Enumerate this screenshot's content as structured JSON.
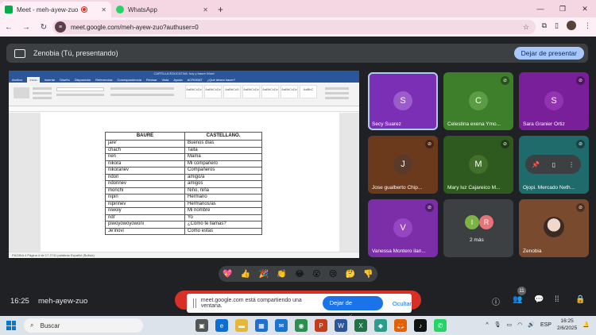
{
  "tabs": [
    {
      "title": "Meet - meh-ayew-zuo",
      "active": true
    },
    {
      "title": "WhatsApp",
      "active": false
    }
  ],
  "address": {
    "url": "meet.google.com/meh-ayew-zuo?authuser=0"
  },
  "presenting": {
    "label": "Zenobia (Tú, presentando)",
    "stop_label": "Dejar de presentar"
  },
  "word": {
    "title": "CARTILLA EDUCATIVA: hoy y baure  Word",
    "tabs": [
      "Archivo",
      "Inicio",
      "Insertar",
      "Diseño",
      "Disposición",
      "Referencias",
      "Correspondencia",
      "Revisar",
      "Vista",
      "Ayuda",
      "ACROBAT",
      "¿Qué desea hacer?"
    ],
    "styles": [
      "AaBbCcDc",
      "AaBbCcDc",
      "AaBbCcD",
      "AaBbCcDc",
      "AaBbCcDc",
      "AaBbCcDc",
      "AaBbC"
    ],
    "status": "PÁGINA 4    Página 4 de 17    2741 palabras    Español (Bolivia)"
  },
  "table": {
    "headers": [
      "BAURE",
      "CASTELLANO."
    ],
    "rows": [
      [
        "jare'",
        "Buenos días"
      ],
      [
        "chach",
        "Taita"
      ],
      [
        "nen",
        "Mama"
      ],
      [
        "nikora",
        "Mi compañero"
      ],
      [
        "nikoranev",
        "Compañeros"
      ],
      [
        "ndori",
        "amigo/a"
      ],
      [
        "ndorinev",
        "amigos"
      ],
      [
        "monchi",
        "Niño, niña"
      ],
      [
        "nipiri",
        "Hermano"
      ],
      [
        "nipirinev",
        "Hermanos/as"
      ],
      [
        "niwoiy",
        "Mi nombre"
      ],
      [
        "ndi'",
        "Yo"
      ],
      [
        "piwoyowoyowoni",
        "¿Cómo te llamas?"
      ],
      [
        "Je'inovi",
        "Como estas"
      ]
    ]
  },
  "participants": [
    {
      "name": "Secy Suarez",
      "initial": "S",
      "bg": "#7b2fb5",
      "av": "#9b5ccb",
      "muted": false
    },
    {
      "name": "Celestina exena Ymo...",
      "initial": "C",
      "bg": "#3e7f2c",
      "av": "#5b9c44",
      "muted": true
    },
    {
      "name": "Sara Granier Ortiz",
      "initial": "S",
      "bg": "#7a1f9a",
      "av": "#9233b3",
      "muted": true
    },
    {
      "name": "Jose gualberto Chip...",
      "initial": "J",
      "bg": "#6b3a1c",
      "av": "#5a3a2a",
      "muted": true
    },
    {
      "name": "Mary luz Cajareico M...",
      "initial": "M",
      "bg": "#2f5a1f",
      "av": "#40702a",
      "muted": true
    },
    {
      "name": "Ojopi. Mercado Neth...",
      "initial": "",
      "bg": "#1f6a6a",
      "av": "#2c8080",
      "muted": true
    },
    {
      "name": "Vanessa Montero ilan...",
      "initial": "V",
      "bg": "#7b2ea8",
      "av": "#9646c2",
      "muted": true
    },
    {
      "name": "2 más",
      "initial": "",
      "bg": "#3c4043",
      "av": "#3c4043",
      "muted": false
    },
    {
      "name": "Zenobia",
      "initial": "",
      "bg": "#7a4a2e",
      "av": "#e8d2c4",
      "muted": true
    }
  ],
  "more": {
    "a": "I",
    "b": "R"
  },
  "reactions": [
    "💖",
    "👍",
    "🎉",
    "👏",
    "😂",
    "😮",
    "😢",
    "🤔",
    "👎"
  ],
  "meeting": {
    "time": "16:25",
    "code": "meh-ayew-zuo",
    "people_count": "11"
  },
  "notice": {
    "text": "meet.google.com está compartiendo una ventana.",
    "stop": "Dejar de compartir",
    "hide": "Ocultar"
  },
  "taskbar": {
    "search": "Buscar",
    "time": "16:25",
    "date": "2/6/2025",
    "lang": "ESP"
  }
}
